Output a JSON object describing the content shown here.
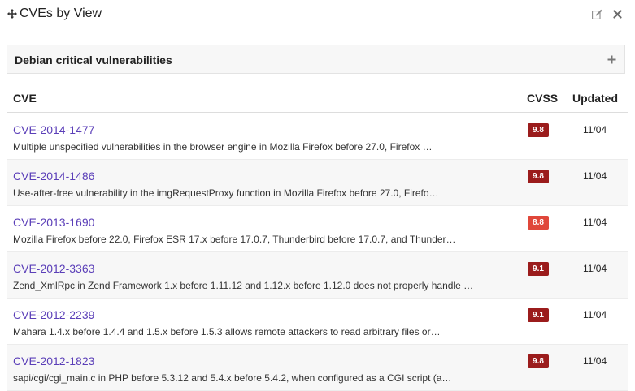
{
  "header": {
    "title": "CVEs by View"
  },
  "section": {
    "title": "Debian critical vulnerabilities"
  },
  "table": {
    "columns": {
      "cve": "CVE",
      "cvss": "CVSS",
      "updated": "Updated"
    },
    "rows": [
      {
        "id": "CVE-2014-1477",
        "description": "Multiple unspecified vulnerabilities in the browser engine in Mozilla Firefox before 27.0, Firefox …",
        "cvss": "9.8",
        "cvss_color": "#9b1c1c",
        "updated": "11/04"
      },
      {
        "id": "CVE-2014-1486",
        "description": "Use-after-free vulnerability in the imgRequestProxy function in Mozilla Firefox before 27.0, Firefo…",
        "cvss": "9.8",
        "cvss_color": "#9b1c1c",
        "updated": "11/04"
      },
      {
        "id": "CVE-2013-1690",
        "description": "Mozilla Firefox before 22.0, Firefox ESR 17.x before 17.0.7, Thunderbird before 17.0.7, and Thunder…",
        "cvss": "8.8",
        "cvss_color": "#e0473a",
        "updated": "11/04"
      },
      {
        "id": "CVE-2012-3363",
        "description": "Zend_XmlRpc in Zend Framework 1.x before 1.11.12 and 1.12.x before 1.12.0 does not properly handle …",
        "cvss": "9.1",
        "cvss_color": "#9b1c1c",
        "updated": "11/04"
      },
      {
        "id": "CVE-2012-2239",
        "description": "Mahara 1.4.x before 1.4.4 and 1.5.x before 1.5.3 allows remote attackers to read arbitrary files or…",
        "cvss": "9.1",
        "cvss_color": "#9b1c1c",
        "updated": "11/04"
      },
      {
        "id": "CVE-2012-1823",
        "description": "sapi/cgi/cgi_main.c in PHP before 5.3.12 and 5.4.x before 5.4.2, when configured as a CGI script (a…",
        "cvss": "9.8",
        "cvss_color": "#9b1c1c",
        "updated": "11/04"
      }
    ]
  },
  "colors": {
    "link": "#5b3fb8",
    "critical_dark": "#9b1c1c",
    "critical_light": "#e0473a"
  },
  "icons": {
    "move": "move-icon",
    "edit": "edit-icon",
    "close": "close-icon",
    "add": "plus-icon"
  }
}
